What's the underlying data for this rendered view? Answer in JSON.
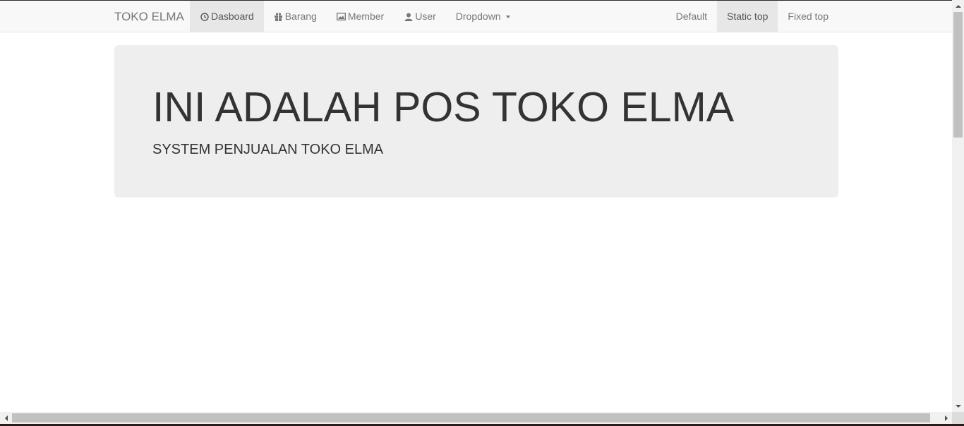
{
  "navbar": {
    "brand": "TOKO ELMA",
    "left_items": [
      {
        "label": "Dasboard",
        "icon": "dashboard-clock-icon",
        "active": true
      },
      {
        "label": "Barang",
        "icon": "gift-icon",
        "active": false
      },
      {
        "label": "Member",
        "icon": "picture-icon",
        "active": false
      },
      {
        "label": "User",
        "icon": "user-icon",
        "active": false
      },
      {
        "label": "Dropdown",
        "icon": "caret-down-icon",
        "active": false
      }
    ],
    "right_items": [
      {
        "label": "Default",
        "active": false
      },
      {
        "label": "Static top",
        "active": true
      },
      {
        "label": "Fixed top",
        "active": false
      }
    ]
  },
  "jumbotron": {
    "title": "INI ADALAH POS TOKO ELMA",
    "subtitle": "SYSTEM PENJUALAN TOKO ELMA"
  },
  "colors": {
    "navbar_bg": "#f8f8f8",
    "nav_active_bg": "#e7e7e7",
    "nav_text": "#777777",
    "jumbotron_bg": "#eeeeee",
    "text": "#333333"
  }
}
